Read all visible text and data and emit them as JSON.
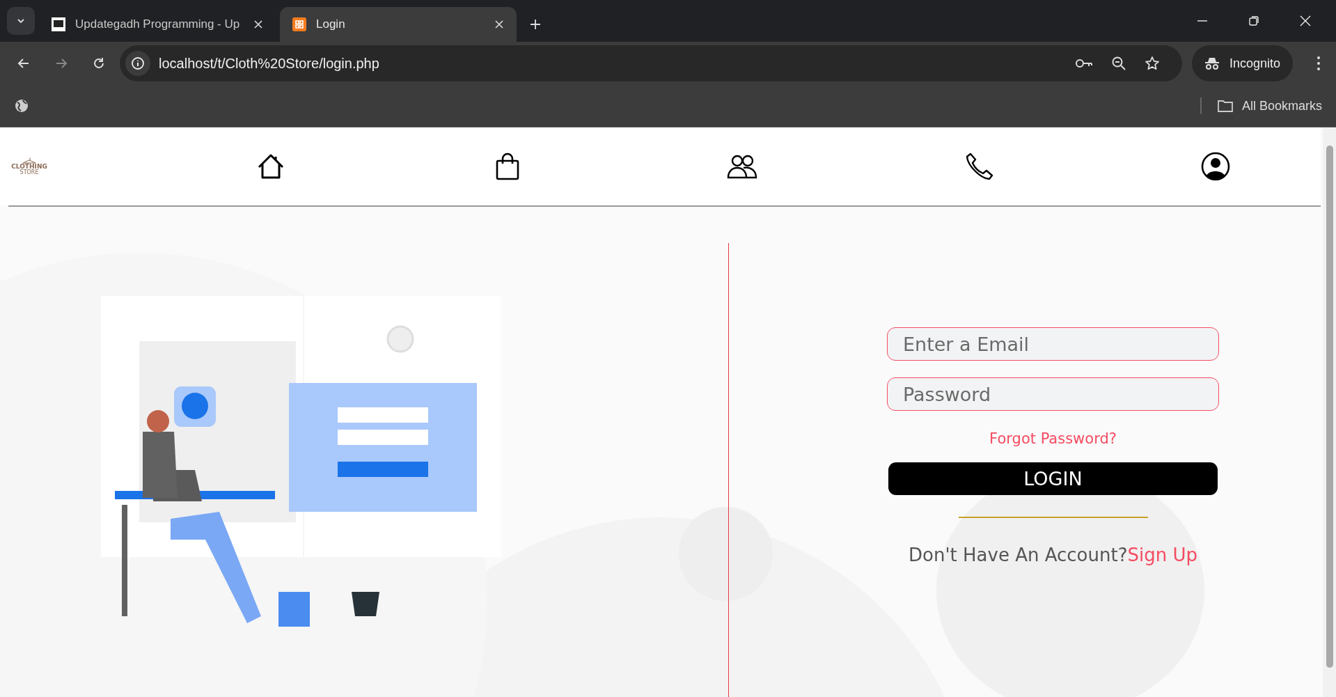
{
  "browser": {
    "tabs": [
      {
        "title": "Updategadh Programming - Up",
        "selected": false,
        "kind": "square"
      },
      {
        "title": "Login",
        "selected": true,
        "kind": "orange"
      }
    ],
    "url": "localhost/t/Cloth%20Store/login.php",
    "profile": "Incognito",
    "bookmarks": "All Bookmarks"
  },
  "logo": {
    "line_1": "CLOTHING",
    "line_2": "STORE"
  },
  "nav": [
    {
      "kind": "home"
    },
    {
      "kind": "bag"
    },
    {
      "kind": "users"
    },
    {
      "kind": "phone"
    },
    {
      "kind": "account"
    }
  ],
  "form": {
    "email_placeholder": "Enter a Email",
    "password_placeholder": "Password",
    "forgot": "Forgot Password?",
    "button": "LOGIN",
    "signup_prompt": "Don't Have An Account?",
    "signup_link": "Sign Up"
  }
}
